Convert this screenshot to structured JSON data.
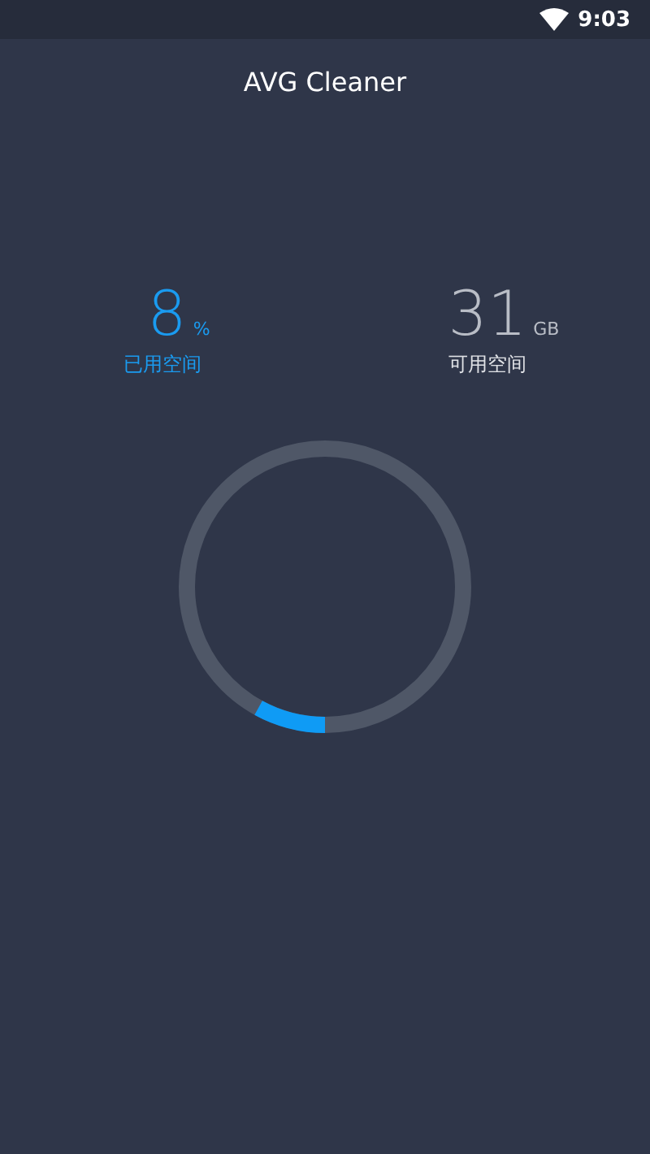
{
  "status_bar": {
    "time": "9:03"
  },
  "title": "AVG Cleaner",
  "stats": [
    {
      "value": "8",
      "unit": "%",
      "label": "已用空间",
      "kind": "used"
    },
    {
      "value": "31",
      "unit": "GB",
      "label": "可用空间",
      "kind": "free"
    }
  ]
}
